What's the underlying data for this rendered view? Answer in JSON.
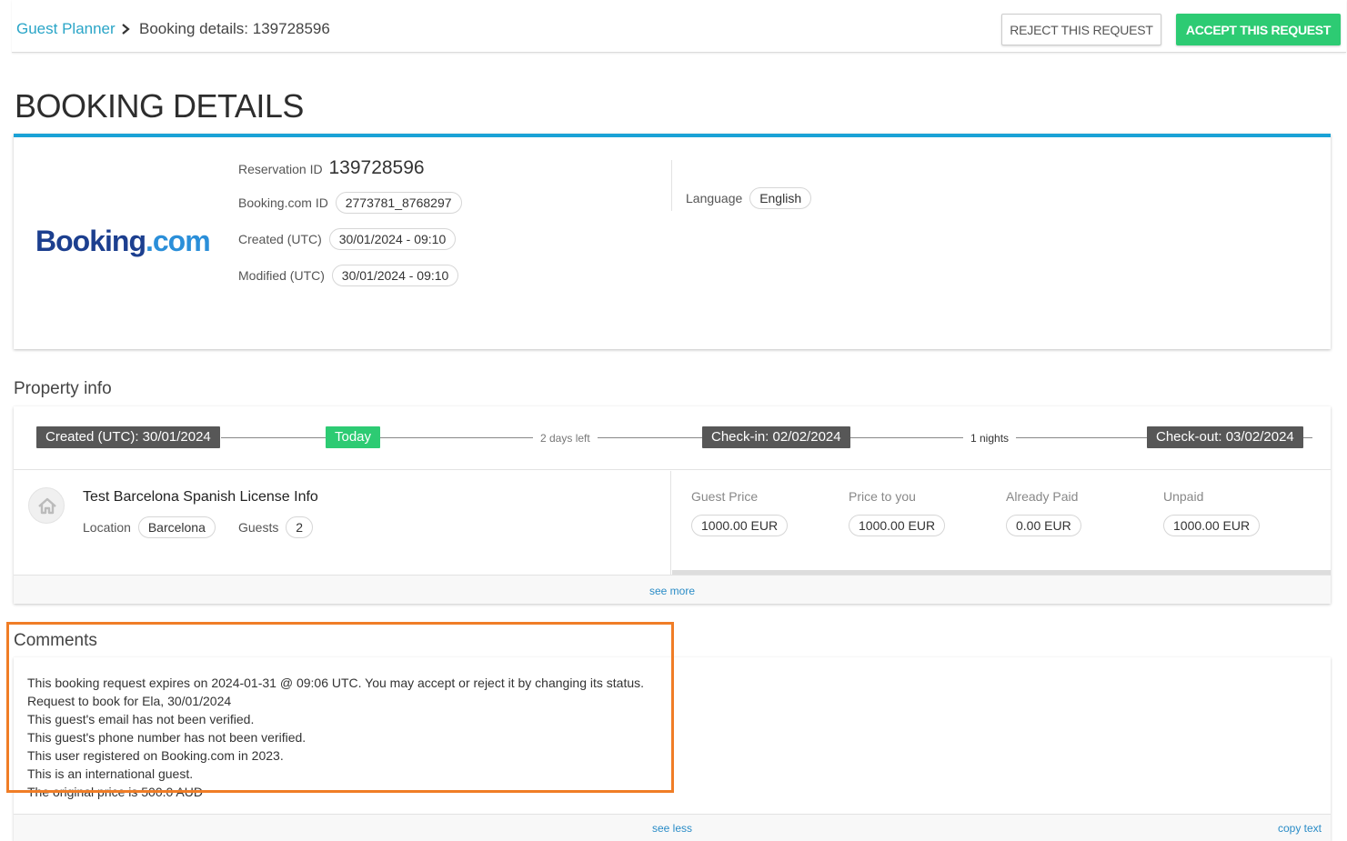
{
  "breadcrumb": {
    "root": "Guest Planner",
    "current": "Booking details: 139728596"
  },
  "actions": {
    "reject_label": "REJECT THIS REQUEST",
    "accept_label": "ACCEPT THIS REQUEST"
  },
  "page_title": "BOOKING DETAILS",
  "booking": {
    "logo_main": "Booking",
    "logo_dot": ".com",
    "reservation_label": "Reservation ID",
    "reservation_id": "139728596",
    "bookingcom_label": "Booking.com ID",
    "bookingcom_id": "2773781_8768297",
    "created_label": "Created (UTC)",
    "created_value": "30/01/2024 - 09:10",
    "modified_label": "Modified (UTC)",
    "modified_value": "30/01/2024 - 09:10",
    "language_label": "Language",
    "language_value": "English"
  },
  "property": {
    "section_title": "Property info",
    "timeline": {
      "created": "Created (UTC): 30/01/2024",
      "today": "Today",
      "days_left": "2 days left",
      "checkin": "Check-in: 02/02/2024",
      "nights": "1 nights",
      "checkout": "Check-out: 03/02/2024"
    },
    "name": "Test Barcelona Spanish License Info",
    "location_label": "Location",
    "location_value": "Barcelona",
    "guests_label": "Guests",
    "guests_value": "2",
    "prices": [
      {
        "label": "Guest Price",
        "value": "1000.00 EUR"
      },
      {
        "label": "Price to you",
        "value": "1000.00 EUR"
      },
      {
        "label": "Already Paid",
        "value": "0.00 EUR"
      },
      {
        "label": "Unpaid",
        "value": "1000.00 EUR"
      }
    ],
    "see_more": "see more"
  },
  "comments": {
    "section_title": "Comments",
    "lines": [
      "This booking request expires on 2024-01-31 @ 09:06 UTC. You may accept or reject it by changing its status.",
      "Request to book for Ela, 30/01/2024",
      "This guest's email has not been verified.",
      "This guest's phone number has not been verified.",
      "This user registered on Booking.com in 2023.",
      "This is an international guest.",
      "The original price is 500.0 AUD"
    ],
    "see_less": "see less",
    "copy_text": "copy text"
  },
  "colors": {
    "accent_blue": "#1aa2d6",
    "accept_green": "#2dcb73",
    "highlight_orange": "#f07d26",
    "link_teal": "#2aa5c7"
  }
}
